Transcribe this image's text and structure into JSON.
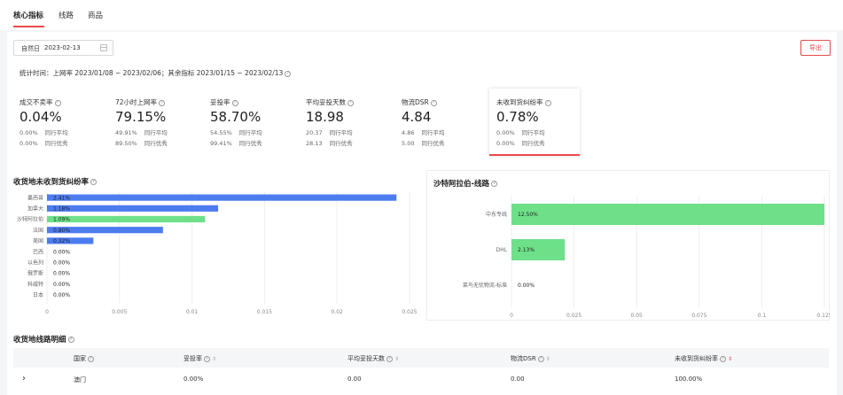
{
  "tabs": [
    {
      "label": "核心指标",
      "active": true
    },
    {
      "label": "线路",
      "active": false
    },
    {
      "label": "商品",
      "active": false
    }
  ],
  "filter": {
    "date_type": "自然日",
    "date_value": "2023-02-13"
  },
  "export_label": "导出",
  "stat_time": "统计时间：上网率 2023/01/08 ~ 2023/02/06；其余指标 2023/01/15 ~ 2023/02/13",
  "metrics": [
    {
      "title": "成交不卖率",
      "value": "0.04%",
      "avg_value": "0.00%",
      "avg_label": "同行平均",
      "best_value": "0.00%",
      "best_label": "同行优秀"
    },
    {
      "title": "72小时上网率",
      "value": "79.15%",
      "avg_value": "49.91%",
      "avg_label": "同行平均",
      "best_value": "89.50%",
      "best_label": "同行优秀"
    },
    {
      "title": "妥投率",
      "value": "58.70%",
      "avg_value": "54.55%",
      "avg_label": "同行平均",
      "best_value": "99.41%",
      "best_label": "同行优秀"
    },
    {
      "title": "平均妥投天数",
      "value": "18.98",
      "avg_value": "20.37",
      "avg_label": "同行平均",
      "best_value": "28.13",
      "best_label": "同行优秀"
    },
    {
      "title": "物流DSR",
      "value": "4.84",
      "avg_value": "4.86",
      "avg_label": "同行平均",
      "best_value": "5.00",
      "best_label": "同行优秀"
    },
    {
      "title": "未收到货纠纷率",
      "value": "0.78%",
      "avg_value": "0.00%",
      "avg_label": "同行平均",
      "best_value": "0.00%",
      "best_label": "同行优秀"
    }
  ],
  "left_chart_title": "收货地未收到货纠纷率",
  "right_chart_title": "沙特阿拉伯-线路",
  "table_title": "收货地线路明细",
  "table": {
    "headers": [
      "国家",
      "妥投率",
      "平均妥投天数",
      "物流DSR",
      "未收到货纠纷率"
    ],
    "rows": [
      {
        "country": "澳门",
        "delivery_rate": "0.00%",
        "avg_days": "0.00",
        "dsr": "0.00",
        "dispute_rate": "100.00%"
      }
    ]
  },
  "colors": {
    "accent": "#e84b4b",
    "blue_bar": "#4d7cf0",
    "green_bar": "#6ee089"
  },
  "chart_data": [
    {
      "type": "bar",
      "orientation": "horizontal",
      "title": "收货地未收到货纠纷率",
      "categories": [
        "墨西哥",
        "加拿大",
        "沙特阿拉伯",
        "法国",
        "美国",
        "巴西",
        "以色列",
        "俄罗斯",
        "科威特",
        "日本"
      ],
      "values": [
        0.0241,
        0.0118,
        0.0109,
        0.008,
        0.0032,
        0,
        0,
        0,
        0,
        0
      ],
      "labels": [
        "2.41%",
        "1.18%",
        "1.09%",
        "0.80%",
        "0.32%",
        "0.00%",
        "0.00%",
        "0.00%",
        "0.00%",
        "0.00%"
      ],
      "highlight": "沙特阿拉伯",
      "xlim": [
        0,
        0.025
      ],
      "xticks": [
        "0",
        "0.005",
        "0.01",
        "0.015",
        "0.02",
        "0.025"
      ]
    },
    {
      "type": "bar",
      "orientation": "horizontal",
      "title": "沙特阿拉伯-线路",
      "categories": [
        "中东专线",
        "DHL",
        "菜鸟无忧物流-标准"
      ],
      "values": [
        0.125,
        0.0213,
        0
      ],
      "labels": [
        "12.50%",
        "2.13%",
        "0.00%"
      ],
      "xlim": [
        0,
        0.125
      ],
      "xticks": [
        "0",
        "0.025",
        "0.05",
        "0.075",
        "0.1",
        "0.125"
      ]
    }
  ]
}
